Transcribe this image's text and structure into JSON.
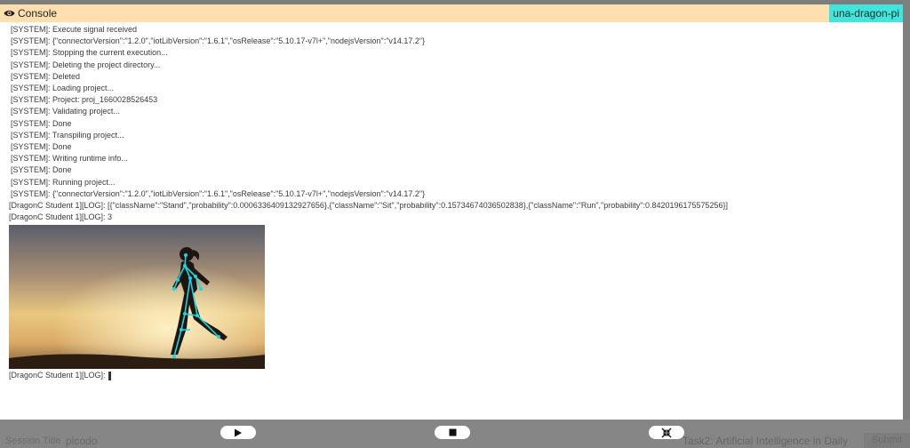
{
  "console": {
    "title": "Console",
    "device": "una-dragon-pi",
    "lines": [
      "[SYSTEM]: Execute signal received",
      "[SYSTEM]: {\"connectorVersion\":\"1.2.0\",\"iotLibVersion\":\"1.6.1\",\"osRelease\":\"5.10.17-v7l+\",\"nodejsVersion\":\"v14.17.2\"}",
      "[SYSTEM]: Stopping the current execution...",
      "[SYSTEM]: Deleting the project directory...",
      "[SYSTEM]: Deleted",
      "[SYSTEM]: Loading project...",
      "[SYSTEM]: Project: proj_1660028526453",
      "[SYSTEM]: Validating project...",
      "[SYSTEM]: Done",
      "[SYSTEM]: Transpiling project...",
      "[SYSTEM]: Done",
      "[SYSTEM]: Writing runtime info...",
      "[SYSTEM]: Done",
      "[SYSTEM]: Running project...",
      "[SYSTEM]: {\"connectorVersion\":\"1.2.0\",\"iotLibVersion\":\"1.6.1\",\"osRelease\":\"5.10.17-v7l+\",\"nodejsVersion\":\"v14.17.2\"}"
    ],
    "log_prediction": "[DragonC Student 1][LOG]: [{\"className\":\"Stand\",\"probability\":0.0006336409132927656},{\"className\":\"Sit\",\"probability\":0.15734674036502838},{\"className\":\"Run\",\"probability\":0.8420196175575256}]",
    "log_count": "[DragonC Student 1][LOG]: 3",
    "prompt": "[DragonC Student 1][LOG]:"
  },
  "background": {
    "title_label": "Session Title",
    "title_value": "picodo",
    "task": "Task2: Artificial Intelligence in Daily",
    "submit_label": "Submit"
  },
  "controls": {
    "play_icon": "play-icon",
    "stop_icon": "stop-icon",
    "collapse_icon": "collapse-icon"
  },
  "colors": {
    "header_bg": "#ffdfb0",
    "badge_bg": "#3fe6dc",
    "skeleton": "#19d6e6"
  }
}
